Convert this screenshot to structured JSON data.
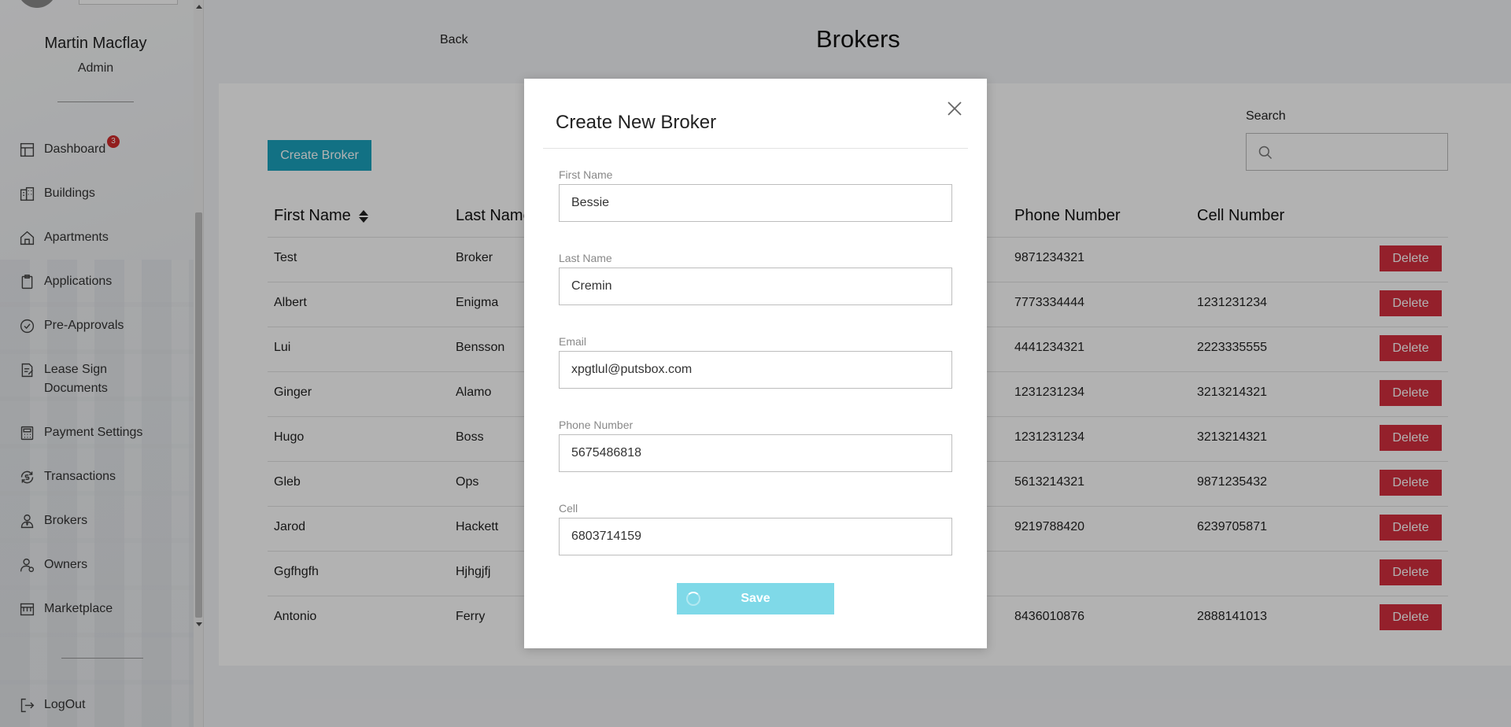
{
  "sidebar": {
    "user_name": "Martin Macflay",
    "user_role": "Admin",
    "items": [
      {
        "label": "Dashboard",
        "icon": "layout-icon",
        "badge": "3"
      },
      {
        "label": "Buildings",
        "icon": "building-icon"
      },
      {
        "label": "Apartments",
        "icon": "home-icon"
      },
      {
        "label": "Applications",
        "icon": "clipboard-icon"
      },
      {
        "label": "Pre-Approvals",
        "icon": "check-circle-icon"
      },
      {
        "label": "Lease Sign",
        "label2": "Documents",
        "icon": "document-sign-icon"
      },
      {
        "label": "Payment Settings",
        "icon": "calculator-icon"
      },
      {
        "label": "Transactions",
        "icon": "refresh-dollar-icon"
      },
      {
        "label": "Brokers",
        "icon": "broker-icon"
      },
      {
        "label": "Owners",
        "icon": "owner-icon"
      },
      {
        "label": "Marketplace",
        "icon": "marketplace-icon"
      }
    ],
    "logout_label": "LogOut"
  },
  "header": {
    "back_label": "Back",
    "title": "Brokers"
  },
  "toolbar": {
    "create_label": "Create Broker",
    "search_label": "Search",
    "search_value": ""
  },
  "table": {
    "columns": [
      "First Name",
      "Last Name",
      "Phone Number",
      "Cell Number"
    ],
    "delete_label": "Delete",
    "rows": [
      {
        "first": "Test",
        "last": "Broker",
        "phone": "9871234321",
        "cell": ""
      },
      {
        "first": "Albert",
        "last": "Enigma",
        "phone": "7773334444",
        "cell": "1231231234"
      },
      {
        "first": "Lui",
        "last": "Bensson",
        "phone": "4441234321",
        "cell": "2223335555"
      },
      {
        "first": "Ginger",
        "last": "Alamo",
        "phone": "1231231234",
        "cell": "3213214321"
      },
      {
        "first": "Hugo",
        "last": "Boss",
        "phone": "1231231234",
        "cell": "3213214321"
      },
      {
        "first": "Gleb",
        "last": "Ops",
        "phone": "5613214321",
        "cell": "9871235432"
      },
      {
        "first": "Jarod",
        "last": "Hackett",
        "phone": "9219788420",
        "cell": "6239705871"
      },
      {
        "first": "Ggfhgfh",
        "last": "Hjhgjfj",
        "phone": "",
        "cell": ""
      },
      {
        "first": "Antonio",
        "last": "Ferry",
        "phone": "8436010876",
        "cell": "2888141013"
      }
    ]
  },
  "modal": {
    "title": "Create New Broker",
    "fields": [
      {
        "label": "First Name",
        "value": "Bessie"
      },
      {
        "label": "Last Name",
        "value": "Cremin"
      },
      {
        "label": "Email",
        "value": "xpgtlul@putsbox.com"
      },
      {
        "label": "Phone Number",
        "value": "5675486818"
      },
      {
        "label": "Cell",
        "value": "6803714159"
      }
    ],
    "save_label": "Save"
  },
  "colors": {
    "accent": "#1aa3bd",
    "danger": "#d42f3e",
    "save_loading": "#7fd9e8",
    "badge": "#d12b2b"
  }
}
